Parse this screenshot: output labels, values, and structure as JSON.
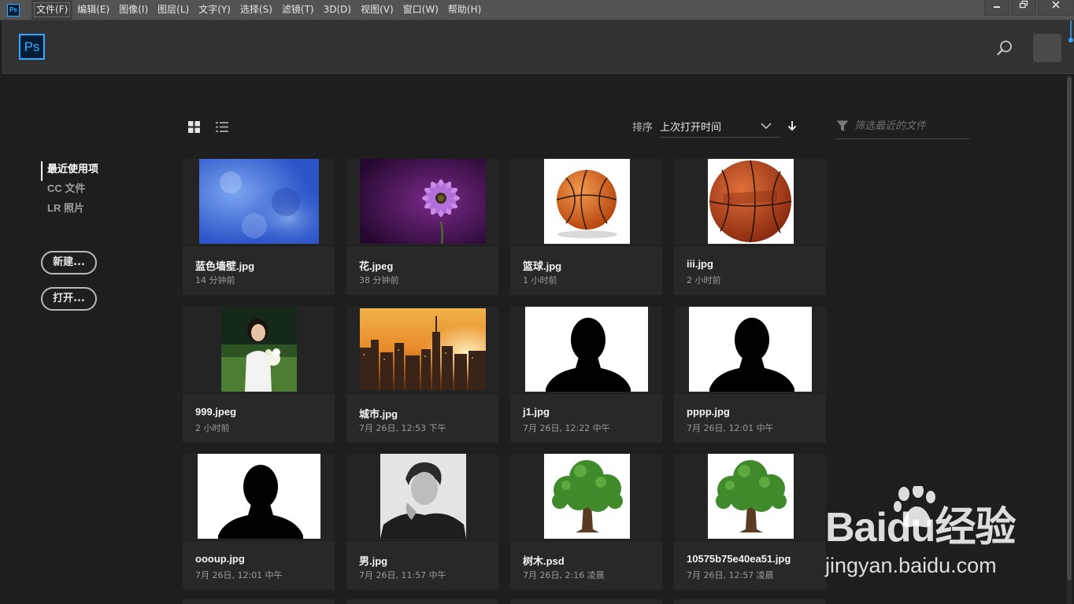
{
  "menubar": {
    "app_icon": "Ps",
    "items": [
      "文件(F)",
      "编辑(E)",
      "图像(I)",
      "图层(L)",
      "文字(Y)",
      "选择(S)",
      "滤镜(T)",
      "3D(D)",
      "视图(V)",
      "窗口(W)",
      "帮助(H)"
    ],
    "window_controls": [
      "minimize-icon",
      "restore-icon",
      "close-icon"
    ]
  },
  "header": {
    "logo": "Ps",
    "icons": [
      "search-icon",
      "avatar"
    ]
  },
  "nav": {
    "items": [
      "最近使用项",
      "CC 文件",
      "LR 照片"
    ],
    "selected": "最近使用项"
  },
  "actions": {
    "new_label": "新建...",
    "open_label": "打开..."
  },
  "toolbar": {
    "sort_label": "排序",
    "sort_value": "上次打开时间",
    "filter_placeholder": "筛选最近的文件"
  },
  "files": [
    {
      "name": "蓝色墙壁.jpg",
      "time": "14 分钟前",
      "thumb": "blue-texture"
    },
    {
      "name": "花.jpeg",
      "time": "38 分钟前",
      "thumb": "purple-flower"
    },
    {
      "name": "篮球.jpg",
      "time": "1 小时前",
      "thumb": "basketball"
    },
    {
      "name": "iii.jpg",
      "time": "2 小时前",
      "thumb": "spalding-basketball"
    },
    {
      "name": "999.jpeg",
      "time": "2 小时前",
      "thumb": "woman-in-field"
    },
    {
      "name": "城市.jpg",
      "time": "7月 26日, 12:53 下午",
      "thumb": "city-sunset"
    },
    {
      "name": "j1.jpg",
      "time": "7月 26日, 12:22 中午",
      "thumb": "silhouette"
    },
    {
      "name": "pppp.jpg",
      "time": "7月 26日, 12:01 中午",
      "thumb": "silhouette"
    },
    {
      "name": "oooup.jpg",
      "time": "7月 26日, 12:01 中午",
      "thumb": "silhouette"
    },
    {
      "name": "男.jpg",
      "time": "7月 26日, 11:57 中午",
      "thumb": "man-portrait"
    },
    {
      "name": "树木.psd",
      "time": "7月 26日, 2:16 凌晨",
      "thumb": "tree"
    },
    {
      "name": "10575b75e40ea51.jpg",
      "time": "7月 26日, 12:57 凌晨",
      "thumb": "tree"
    }
  ],
  "watermark": {
    "brand": "Baidu经验",
    "url": "jingyan.baidu.com"
  },
  "colors": {
    "accent": "#31a8ff",
    "background": "#1e1e1e",
    "card": "#282828",
    "menubar": "#535353"
  }
}
